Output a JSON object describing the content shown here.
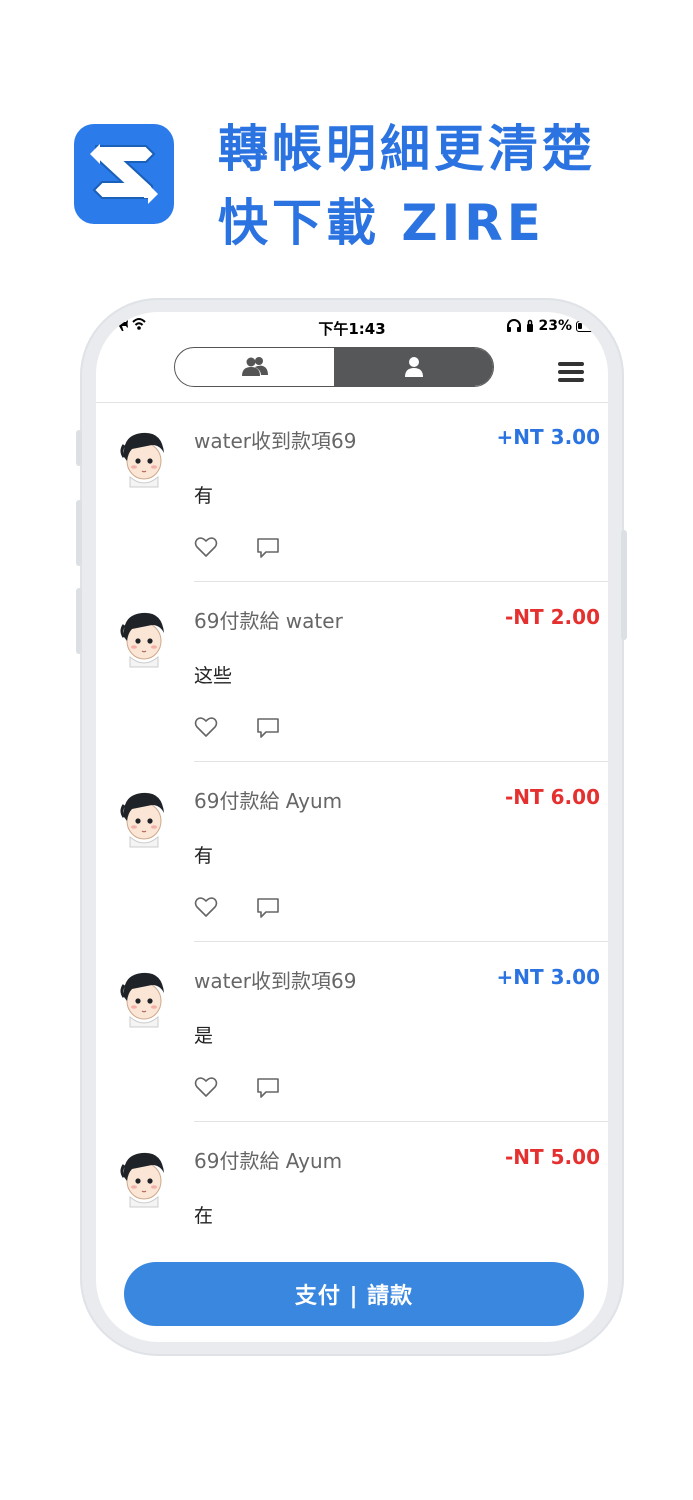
{
  "promo": {
    "headline_line1": "轉帳明細更清楚",
    "headline_line2": "快下載 ZIRE"
  },
  "status": {
    "time": "下午1:43",
    "battery": "23%"
  },
  "nav": {
    "tab_group_icon": "group-icon",
    "tab_person_icon": "person-icon",
    "menu_icon": "menu-icon"
  },
  "feed": [
    {
      "title": "water收到款項69",
      "amount": "+NT 3.00",
      "type": "pos",
      "note": "有"
    },
    {
      "title": "69付款給 water",
      "amount": "-NT 2.00",
      "type": "neg",
      "note": "这些"
    },
    {
      "title": "69付款給 Ayum",
      "amount": "-NT 6.00",
      "type": "neg",
      "note": "有"
    },
    {
      "title": "water收到款項69",
      "amount": "+NT 3.00",
      "type": "pos",
      "note": "是"
    },
    {
      "title": "69付款給 Ayum",
      "amount": "-NT 5.00",
      "type": "neg",
      "note": "在"
    }
  ],
  "actions": {
    "pay_request_label": "支付 | 請款"
  },
  "colors": {
    "accent": "#2a73e0",
    "positive": "#2a73e0",
    "negative": "#e53030",
    "button": "#3a87df"
  }
}
